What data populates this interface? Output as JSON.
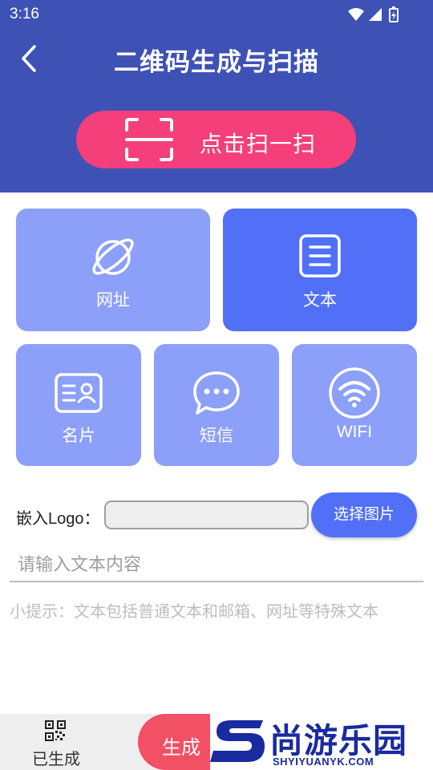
{
  "status_bar": {
    "time": "3:16"
  },
  "header": {
    "title": "二维码生成与扫描",
    "scan_label": "点击扫一扫"
  },
  "tiles": [
    {
      "label": "网址",
      "icon": "planet-icon",
      "active": false
    },
    {
      "label": "文本",
      "icon": "document-icon",
      "active": true
    },
    {
      "label": "名片",
      "icon": "contact-card-icon",
      "active": false
    },
    {
      "label": "短信",
      "icon": "chat-bubble-icon",
      "active": false
    },
    {
      "label": "WIFI",
      "icon": "wifi-icon",
      "active": false
    }
  ],
  "logo": {
    "label": "嵌入Logo：",
    "input_value": "",
    "choose_label": "选择图片"
  },
  "text_input": {
    "placeholder": "请输入文本内容",
    "value": ""
  },
  "hint": "小提示：文本包括普通文本和邮箱、网址等特殊文本",
  "bottom_bar": {
    "generated_label": "已生成",
    "generate_label": "生成"
  },
  "watermark": {
    "brand_cn": "尚游乐园",
    "brand_en": "SHYIYUANYK.COM"
  },
  "colors": {
    "header": "#3e52b5",
    "scan_button": "#f43f7a",
    "tile": "#8c9ff9",
    "tile_active": "#5170f7",
    "generate_button": "#f25065"
  }
}
